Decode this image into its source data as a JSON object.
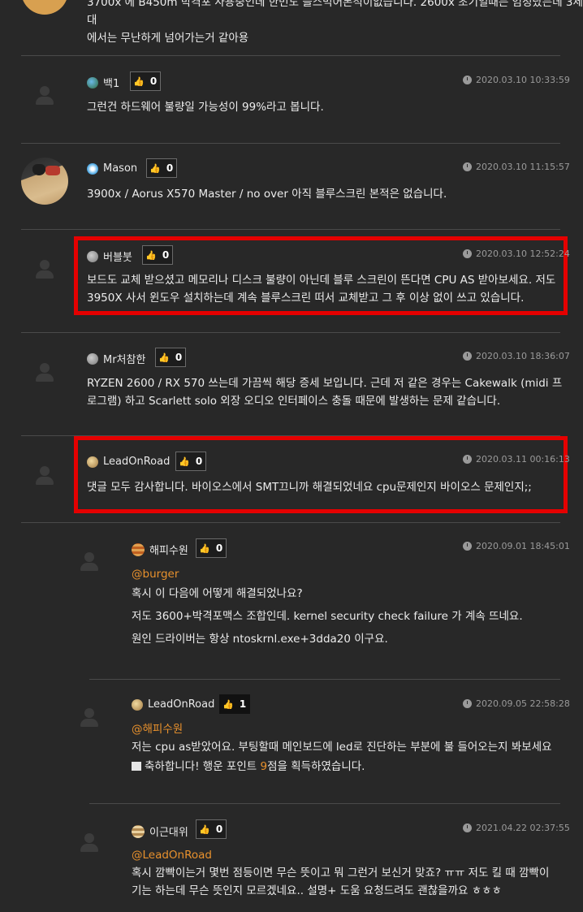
{
  "top_comment": {
    "line1": "3700x 에 B450m 박격포 사용중인데 한번도 블스먹어본적이없습니다. 2600x 초기일때는 엄청났는데 3세대",
    "line2": "에서는 무난하게 넘어가는거 같아용"
  },
  "comments": [
    {
      "nick": "백1",
      "likes": "0",
      "date": "2020.03.10 10:33:59",
      "text": [
        "그런건 하드웨어 불량일 가능성이 99%라고 봅니다."
      ]
    },
    {
      "nick": "Mason",
      "likes": "0",
      "date": "2020.03.10 11:15:57",
      "text": [
        "3900x / Aorus X570 Master / no over 아직 블루스크린 본적은 없습니다."
      ]
    },
    {
      "nick": "버블붓",
      "likes": "0",
      "date": "2020.03.10 12:52:24",
      "text": [
        "보드도 교체 받으셨고 메모리나 디스크 불량이 아닌데 블루 스크린이 뜬다면 CPU AS 받아보세요. 저도",
        "3950X 사서 윈도우 설치하는데 계속 블루스크린 떠서 교체받고 그 후 이상 없이 쓰고 있습니다."
      ]
    },
    {
      "nick": "Mr처참한",
      "likes": "0",
      "date": "2020.03.10 18:36:07",
      "text": [
        "RYZEN 2600 / RX 570 쓰는데 가끔씩 해당 증세 보입니다. 근데 저 같은 경우는 Cakewalk (midi 프",
        "로그램) 하고 Scarlett solo 외장 오디오 인터페이스 충돌 때문에 발생하는 문제 같습니다."
      ]
    },
    {
      "nick": "LeadOnRoad",
      "likes": "0",
      "date": "2020.03.11 00:16:13",
      "text": [
        "댓글 모두 감사합니다. 바이오스에서 SMT끄니까 해결되었네요 cpu문제인지 바이오스 문제인지;;"
      ]
    }
  ],
  "replies": [
    {
      "nick": "해피수원",
      "likes": "0",
      "date": "2020.09.01 18:45:01",
      "mention": "@burger",
      "text": [
        "혹시 이 다음에 어떻게 해결되었나요?",
        "저도 3600+박격포맥스 조합인데. kernel security check failure 가 계속 뜨네요.",
        "원인 드라이버는 항상 ntoskrnl.exe+3dda20 이구요."
      ]
    },
    {
      "nick": "LeadOnRoad",
      "likes": "1",
      "date": "2020.09.05 22:58:28",
      "mention": "@해피수원",
      "text": [
        "저는 cpu as받았어요. 부팅할때 메인보드에 led로 진단하는 부분에 불 들어오는지 봐보세요"
      ],
      "point_prefix": "축하합니다! 행운 포인트 ",
      "point_value": "9",
      "point_suffix": "점을 획득하였습니다."
    },
    {
      "nick": "이근대위",
      "likes": "0",
      "date": "2021.04.22 02:37:55",
      "mention": "@LeadOnRoad",
      "text": [
        "혹시 깜빡이는거 몇번 점등이면 무슨 뜻이고 뭐 그런거 보신거 맞죠? ㅠㅠ 저도 킬 때 깜빡이",
        "기는 하는데 무슨 뜻인지 모르겠네요.. 설명+ 도움 요청드려도 괜찮을까요 ㅎㅎㅎ"
      ]
    }
  ],
  "icons": {
    "like": "thumbs-up-icon",
    "clock": "clock-icon",
    "avatar": "user-placeholder-icon"
  },
  "colors": {
    "highlight": "#e50000",
    "mention": "#e8912d",
    "background": "#282828"
  }
}
